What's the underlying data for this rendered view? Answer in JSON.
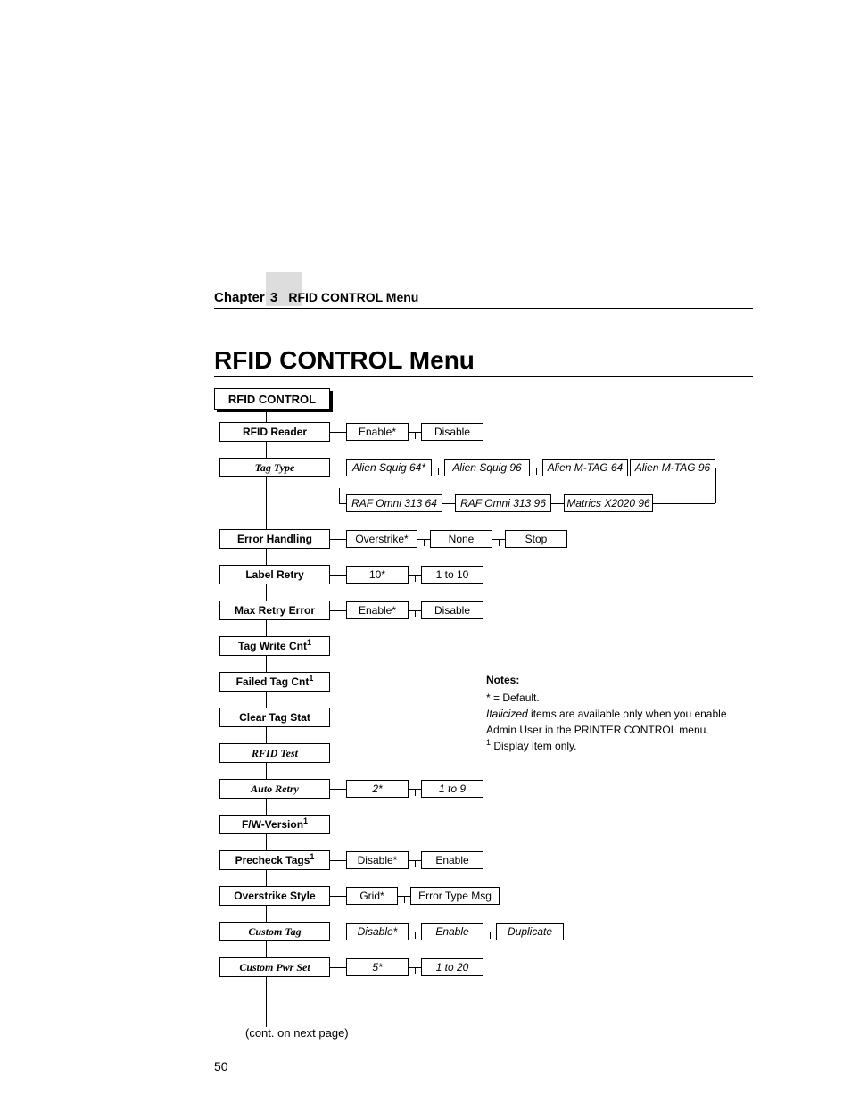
{
  "header": {
    "chapter": "Chapter",
    "num": "3",
    "title": "RFID CONTROL Menu"
  },
  "section_title": "RFID CONTROL Menu",
  "root": "RFID CONTROL",
  "rows": {
    "rfid_reader": {
      "label": "RFID Reader",
      "opts": [
        "Enable*",
        "Disable"
      ]
    },
    "tag_type": {
      "label": "Tag Type",
      "opts1": [
        "Alien Squig 64*",
        "Alien Squig 96",
        "Alien M-TAG 64",
        "Alien M-TAG 96"
      ],
      "opts2": [
        "RAF Omni 313 64",
        "RAF Omni 313 96",
        "Matrics X2020 96"
      ]
    },
    "error_handling": {
      "label": "Error Handling",
      "opts": [
        "Overstrike*",
        "None",
        "Stop"
      ]
    },
    "label_retry": {
      "label": "Label Retry",
      "opts": [
        "10*",
        "1 to 10"
      ]
    },
    "max_retry": {
      "label": "Max Retry Error",
      "opts": [
        "Enable*",
        "Disable"
      ]
    },
    "tag_write": {
      "label": "Tag Write Cnt"
    },
    "failed_tag": {
      "label": "Failed Tag Cnt"
    },
    "clear_tag": {
      "label": "Clear Tag Stat"
    },
    "rfid_test": {
      "label": "RFID Test"
    },
    "auto_retry": {
      "label": "Auto Retry",
      "opts": [
        "2*",
        "1 to 9"
      ]
    },
    "fw_version": {
      "label": "F/W-Version"
    },
    "precheck": {
      "label": "Precheck Tags",
      "opts": [
        "Disable*",
        "Enable"
      ]
    },
    "overstrike": {
      "label": "Overstrike Style",
      "opts": [
        "Grid*",
        "Error Type Msg"
      ]
    },
    "custom_tag": {
      "label": "Custom Tag",
      "opts": [
        "Disable*",
        "Enable",
        "Duplicate"
      ]
    },
    "custom_pwr": {
      "label": "Custom Pwr Set",
      "opts": [
        "5*",
        "1 to 20"
      ]
    }
  },
  "notes": {
    "heading": "Notes:",
    "line1": "* = Default.",
    "line2a": "Italicized",
    "line2b": " items are available only when you enable Admin User in the PRINTER CONTROL menu.",
    "line3": " Display item only."
  },
  "cont": "(cont. on next page)",
  "pageno": "50"
}
